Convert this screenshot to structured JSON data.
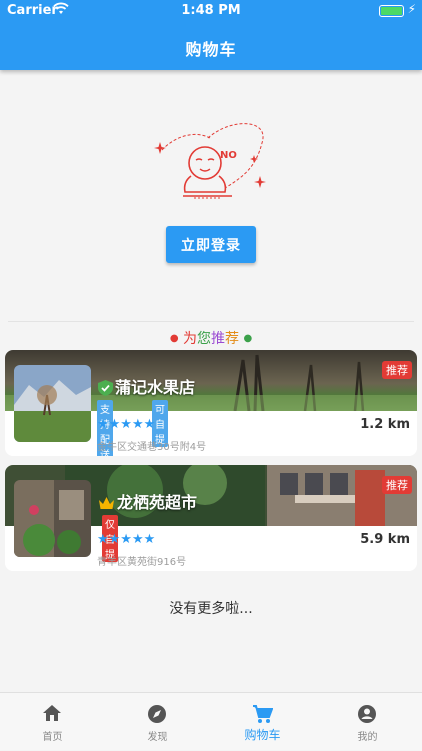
{
  "status_bar": {
    "carrier": "Carrier",
    "time": "1:48 PM"
  },
  "header": {
    "title": "购物车"
  },
  "empty_state": {
    "illustration_text": "NO",
    "login_button": "立即登录"
  },
  "recommend": {
    "title_parts": [
      "为",
      "您",
      "推",
      "荐"
    ],
    "title_colors": [
      "#e23b35",
      "#3ba14a",
      "#9b4bd3",
      "#e38c18"
    ]
  },
  "stores": [
    {
      "name": "蒲记水果店",
      "tags": [
        "支持配送",
        "可自提"
      ],
      "badge": "推荐",
      "stars": "★★★★★",
      "distance": "1.2 km",
      "address": "金牛区交通巷30号附4号",
      "icon": "verified-shield-icon"
    },
    {
      "name": "龙栖苑超市",
      "tags": [
        "仅自提"
      ],
      "badge": "推荐",
      "stars": "★★★★★",
      "distance": "5.9 km",
      "address": "青羊区黄苑街916号",
      "icon": "crown-icon"
    }
  ],
  "footer_text": "没有更多啦...",
  "tabs": [
    {
      "label": "首页",
      "icon": "home-icon"
    },
    {
      "label": "发现",
      "icon": "compass-icon"
    },
    {
      "label": "购物车",
      "icon": "cart-icon"
    },
    {
      "label": "我的",
      "icon": "account-icon"
    }
  ],
  "colors": {
    "primary": "#2b9af3",
    "tag_red": "#e23b35",
    "tag_blue": "#4fa7ec"
  }
}
